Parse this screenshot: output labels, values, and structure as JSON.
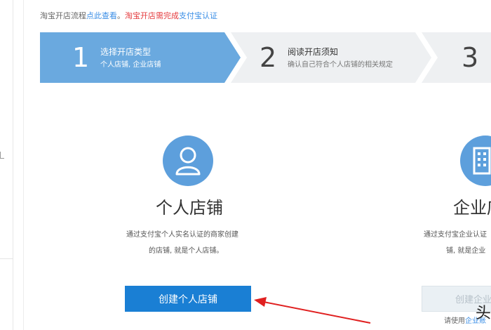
{
  "notice": {
    "prefix": "淘宝开店流程",
    "link": "点此查看",
    "sep": "。",
    "warning": "淘宝开店需完成",
    "alipay_link": "支付宝认证"
  },
  "steps": [
    {
      "num": "1",
      "title": "选择开店类型",
      "sub": "个人店铺, 企业店铺",
      "active": true
    },
    {
      "num": "2",
      "title": "阅读开店须知",
      "sub": "确认自己符合个人店铺的相关规定",
      "active": false
    },
    {
      "num": "3",
      "active": false
    }
  ],
  "personal": {
    "title": "个人店铺",
    "desc_line1": "通过支付宝个人实名认证的商家创建",
    "desc_line2": "的店铺, 就是个人店铺。",
    "button": "创建个人店铺"
  },
  "enterprise": {
    "title": "企业店",
    "desc_line1": "通过支付宝企业认证",
    "desc_line2": "铺, 就是企业",
    "button": "创建企业",
    "tip_prefix": "请使用",
    "tip_link": "企业账"
  },
  "watermark": "头",
  "colors": {
    "step_active": "#6aa9df",
    "step_inactive": "#eef0f2",
    "primary": "#1a7fd4",
    "icon_circle": "#5d9fdc",
    "arrow": "#e02020"
  }
}
